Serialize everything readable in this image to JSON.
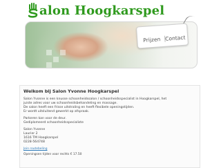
{
  "header": {
    "logo_text": "alon Hoogkarspel",
    "logo_initial_icon": "hand-s-icon",
    "brand_color": "#2f9a1e"
  },
  "nav": {
    "items": [
      {
        "label": "Prijzen"
      },
      {
        "label": "Contact"
      }
    ]
  },
  "content": {
    "title": "Welkom bij Salon Yvonne Hoogkarspel",
    "intro": [
      "Salon Yvonne is een knusse schoonheidssalon / schoonheidsspecialist in Hoogkarspel, het",
      "juiste adres voor uw schoonheidsbehandeling en massage.",
      "De salon heeft een frisse uitstraling en heeft flexibele openingstijden.",
      "Er wordt uitsluitend gewerkt op afspraak."
    ],
    "parking": [
      "Parkeren kan voor de deur.",
      "Gediplomeerd schoonheidsspecialiste"
    ],
    "address": [
      "Salon Yvonne",
      "Laurier 2",
      "1616 TM Hoogkarspel",
      "0228-564748"
    ],
    "route_link": "Join routebeling",
    "hours_teaser": "Openingsen tijden voor rechts € 17.50"
  }
}
